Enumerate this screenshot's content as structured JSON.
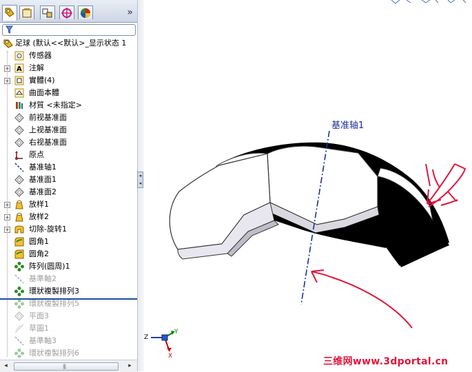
{
  "tree": {
    "items": [
      {
        "label": "足球 (默认<<默认>_显示状态 1",
        "icon": "part-icon",
        "expand": "",
        "dim": false,
        "root": true
      },
      {
        "label": "传感器",
        "icon": "sensor-icon",
        "expand": "",
        "dim": false
      },
      {
        "label": "注解",
        "icon": "annotation-icon",
        "expand": "+",
        "dim": false
      },
      {
        "label": "實體(4)",
        "icon": "solid-bodies-icon",
        "expand": "+",
        "dim": false
      },
      {
        "label": "曲面本體",
        "icon": "surface-bodies-icon",
        "expand": "",
        "dim": false
      },
      {
        "label": "材質 <未指定>",
        "icon": "material-icon",
        "expand": "",
        "dim": false
      },
      {
        "label": "前视基准面",
        "icon": "plane-icon",
        "expand": "",
        "dim": false
      },
      {
        "label": "上视基准面",
        "icon": "plane-icon",
        "expand": "",
        "dim": false
      },
      {
        "label": "右视基准面",
        "icon": "plane-icon",
        "expand": "",
        "dim": false
      },
      {
        "label": "原点",
        "icon": "origin-icon",
        "expand": "",
        "dim": false
      },
      {
        "label": "基准轴1",
        "icon": "axis-icon",
        "expand": "",
        "dim": false
      },
      {
        "label": "基准面1",
        "icon": "plane-icon",
        "expand": "",
        "dim": false
      },
      {
        "label": "基准面2",
        "icon": "plane-icon",
        "expand": "",
        "dim": false
      },
      {
        "label": "放样1",
        "icon": "loft-icon",
        "expand": "+",
        "dim": false
      },
      {
        "label": "放样2",
        "icon": "loft-icon",
        "expand": "+",
        "dim": false
      },
      {
        "label": "切除-旋转1",
        "icon": "cut-revolve-icon",
        "expand": "+",
        "dim": false
      },
      {
        "label": "圆角1",
        "icon": "fillet-icon",
        "expand": "",
        "dim": false
      },
      {
        "label": "圆角2",
        "icon": "fillet-icon",
        "expand": "",
        "dim": false
      },
      {
        "label": "阵列(圆周)1",
        "icon": "circular-pattern-icon",
        "expand": "",
        "dim": false
      },
      {
        "label": "基準軸2",
        "icon": "axis-icon",
        "expand": "",
        "dim": true
      },
      {
        "label": "環狀複製排列3",
        "icon": "circular-pattern-icon",
        "expand": "",
        "dim": false
      },
      {
        "label": "環狀複製排列5",
        "icon": "circular-pattern-icon",
        "expand": "",
        "dim": true
      },
      {
        "label": "平面3",
        "icon": "plane-icon",
        "expand": "",
        "dim": true
      },
      {
        "label": "草圖1",
        "icon": "sketch-icon",
        "expand": "",
        "dim": true
      },
      {
        "label": "基準軸3",
        "icon": "axis-icon",
        "expand": "",
        "dim": true
      },
      {
        "label": "環狀複製排列6",
        "icon": "circular-pattern-icon",
        "expand": "",
        "dim": true
      }
    ]
  },
  "viewport": {
    "axis_label": "基准轴1",
    "watermark": "三维网www.3dportal.cn",
    "triad": {
      "x": "X",
      "y": "Y",
      "z": "Z"
    }
  },
  "colors": {
    "axis": "#1a2f99",
    "annotation": "#e3143d",
    "panel_border": "#9aa8bd"
  }
}
